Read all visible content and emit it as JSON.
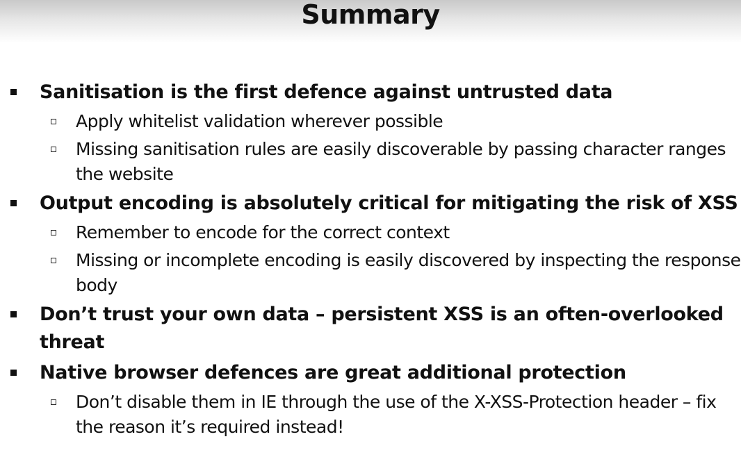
{
  "slide": {
    "title": "Summary",
    "bullets": [
      {
        "text": "Sanitisation is the first defence against untrusted data",
        "subs": [
          "Apply whitelist validation wherever possible",
          "Missing sanitisation rules are easily discoverable by passing character ranges the website"
        ]
      },
      {
        "text": "Output encoding is absolutely critical for mitigating the risk of XSS",
        "subs": [
          "Remember to encode for the correct context",
          "Missing or incomplete encoding is easily discovered by inspecting the response body"
        ]
      },
      {
        "text": "Don’t trust your own data – persistent XSS is an often-overlooked threat",
        "subs": []
      },
      {
        "text": "Native browser defences are great additional protection",
        "subs": [
          "Don’t disable them in IE through the use of the X-XSS-Protection header – fix the reason it’s required instead!"
        ]
      }
    ]
  }
}
